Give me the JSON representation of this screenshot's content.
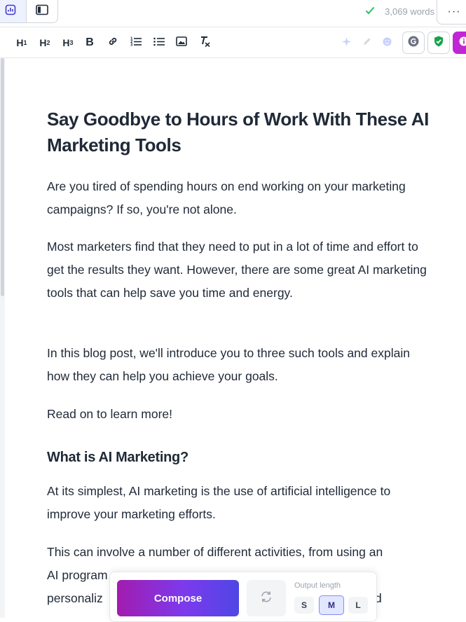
{
  "topbar": {
    "word_count": "3,069 words",
    "more_label": "···"
  },
  "toolbar": {
    "h1": "H",
    "h1_sub": "1",
    "h2": "H",
    "h2_sub": "2",
    "h3": "H",
    "h3_sub": "3",
    "bold": "B"
  },
  "document": {
    "title": "Say Goodbye to Hours of Work With These AI Marketing Tools",
    "p1": "Are you tired of spending hours on end working on your marketing campaigns? If so, you're not alone.",
    "p2": "Most marketers find that they need to put in a lot of time and effort to get the results they want. However, there are some great AI marketing tools that can help save you time and energy.",
    "p3": "In this blog post, we'll introduce you to three such tools and explain how they can help you achieve your goals.",
    "p4": "Read on to learn more!",
    "h2": "What is AI Marketing?",
    "p5": "At its simplest, AI marketing is the use of artificial intelligence to improve your marketing efforts.",
    "p6_line1": "This can involve a number of different activities, from using an",
    "p6_line2": "AI program",
    "p6_line3": "personaliz",
    "p6_tail": "d"
  },
  "compose": {
    "button_label": "Compose",
    "output_length_label": "Output length",
    "sizes": [
      "S",
      "M",
      "L"
    ],
    "selected_size": "M"
  },
  "colors": {
    "accent": "#7c3aed",
    "check": "#22c55e",
    "shield": "#16a34a",
    "magenta": "#c026d3"
  }
}
